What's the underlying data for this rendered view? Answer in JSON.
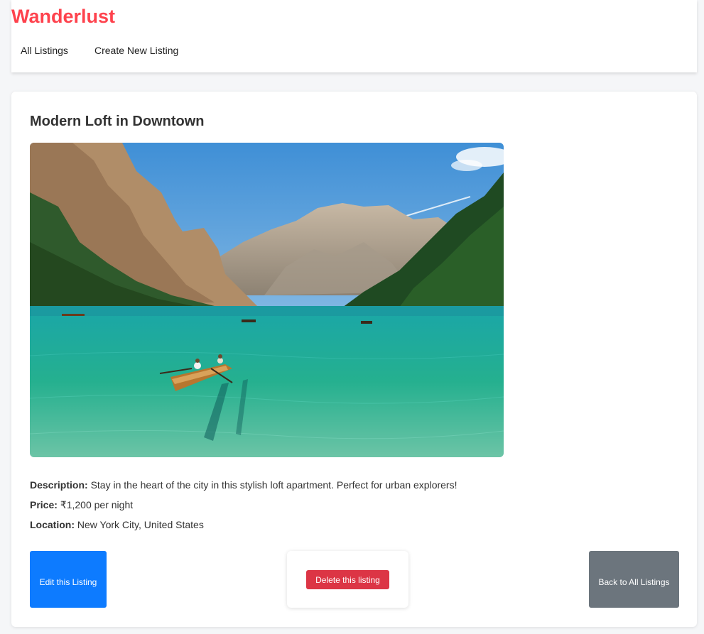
{
  "header": {
    "brand": "Wanderlust",
    "nav": [
      {
        "label": "All Listings"
      },
      {
        "label": "Create New Listing"
      }
    ]
  },
  "listing": {
    "title": "Modern Loft in Downtown",
    "description_label": "Description:",
    "description": "Stay in the heart of the city in this stylish loft apartment. Perfect for urban explorers!",
    "price_label": "Price:",
    "price": "₹1,200 per night",
    "location_label": "Location:",
    "location": "New York City, United States"
  },
  "actions": {
    "edit_label": "Edit this Listing",
    "delete_label": "Delete this listing",
    "back_label": "Back to All Listings"
  },
  "colors": {
    "brand": "#fe424d",
    "edit": "#0d7bff",
    "delete": "#dc3545",
    "back": "#6c757d"
  }
}
